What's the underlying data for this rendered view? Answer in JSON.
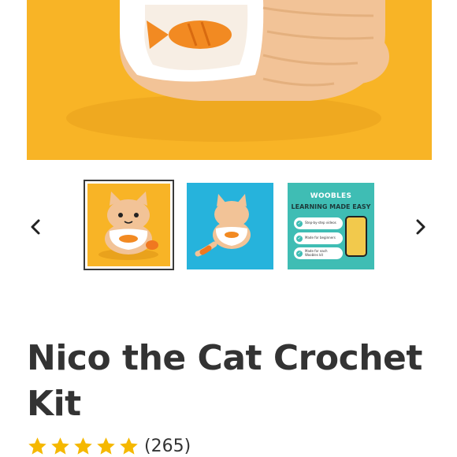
{
  "gallery": {
    "prev_icon": "chevron-left-icon",
    "next_icon": "chevron-right-icon",
    "thumb3": {
      "title": "WOOBLES",
      "subtitle": "LEARNING MADE EASY",
      "items": [
        "Step-by-step videos",
        "Made for beginners",
        "Made for each Woobles kit"
      ]
    },
    "colors": {
      "hero_bg": "#f8b426",
      "thumb2_bg": "#26b3dc",
      "thumb3_bg": "#3fbdb4"
    }
  },
  "product": {
    "title": "Nico the Cat Crochet Kit",
    "rating": 5,
    "reviews": "(265)",
    "star_color": "#f5b800"
  }
}
